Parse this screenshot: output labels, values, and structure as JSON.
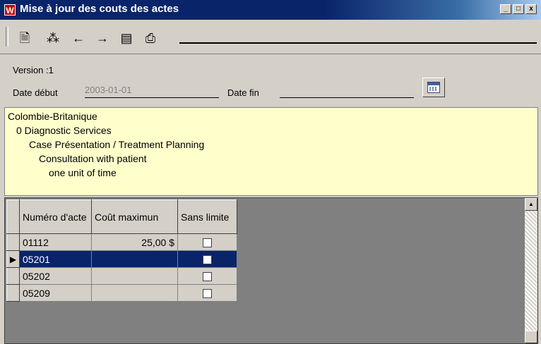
{
  "window": {
    "icon_letter": "W",
    "title": "Mise à jour des couts des actes",
    "controls": [
      "_",
      "□",
      "x"
    ]
  },
  "toolbar": {
    "icons": [
      "open-document-icon",
      "new-record-icon",
      "previous-arrow-icon",
      "next-arrow-icon",
      "list-icon",
      "print-icon"
    ],
    "glyphs": [
      "🗎",
      "⁂",
      "←",
      "→",
      "▤",
      "⎙"
    ]
  },
  "form": {
    "version_label": "Version :1",
    "date_debut_label": "Date début",
    "date_debut_value": "2003-01-01",
    "date_fin_label": "Date fin",
    "date_fin_value": ""
  },
  "tree": {
    "lines": [
      "Colombie-Britanique",
      "0 Diagnostic Services",
      "Case Présentation / Treatment Planning",
      "Consultation with patient",
      "one unit of time"
    ]
  },
  "grid": {
    "headers": {
      "numero": "Numéro d'acte",
      "cout": "Coût maximun",
      "sans_limite": "Sans limite"
    },
    "rows": [
      {
        "numero": "01112",
        "cout": "25,00 $",
        "sans_limite": false,
        "selected": false
      },
      {
        "numero": "05201",
        "cout": "",
        "sans_limite": false,
        "selected": true
      },
      {
        "numero": "05202",
        "cout": "",
        "sans_limite": false,
        "selected": false
      },
      {
        "numero": "05209",
        "cout": "",
        "sans_limite": false,
        "selected": false
      }
    ]
  },
  "colors": {
    "title_bar": "#0a246a",
    "tree_bg": "#ffffcc",
    "selection": "#0a246a"
  }
}
